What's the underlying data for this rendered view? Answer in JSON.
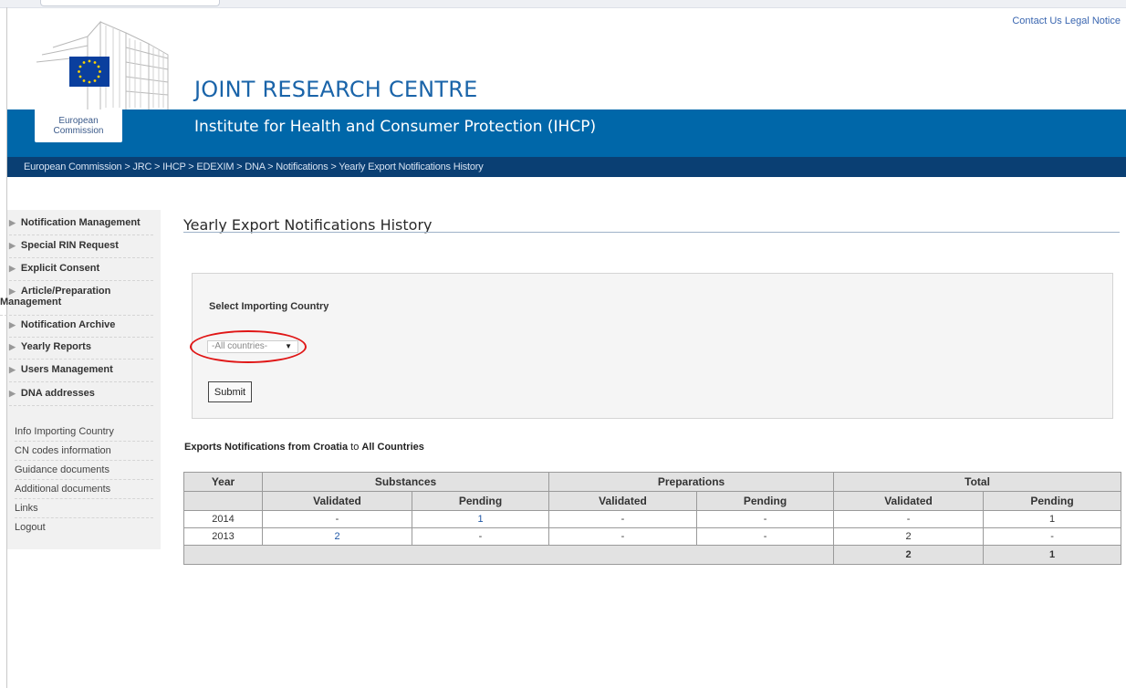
{
  "header": {
    "contact_us": "Contact Us",
    "legal_notice": "Legal Notice",
    "org_title": "JOINT RESEARCH CENTRE",
    "institute": "Institute for Health and Consumer Protection (IHCP)",
    "ec_label_line1": "European",
    "ec_label_line2": "Commission"
  },
  "breadcrumb": "European Commission > JRC > IHCP > EDEXIM > DNA > Notifications > Yearly Export Notifications History",
  "sidebar": {
    "nav": [
      {
        "label": "Notification Management"
      },
      {
        "label": "Special RIN Request"
      },
      {
        "label": "Explicit Consent"
      },
      {
        "label": "Article/Preparation Management"
      },
      {
        "label": "Notification Archive"
      },
      {
        "label": "Yearly Reports"
      },
      {
        "label": "Users Management"
      },
      {
        "label": "DNA addresses"
      }
    ],
    "links": [
      {
        "label": "Info Importing Country"
      },
      {
        "label": "CN codes information"
      },
      {
        "label": "Guidance documents"
      },
      {
        "label": "Additional documents"
      },
      {
        "label": "Links"
      },
      {
        "label": "Logout"
      }
    ]
  },
  "main": {
    "page_title": "Yearly Export Notifications History",
    "select_label": "Select Importing Country",
    "select_value": "-All countries-",
    "submit_label": "Submit",
    "exports_heading": {
      "prefix": "Exports Notifications from",
      "from_country": "Croatia",
      "mid": "to",
      "to_country": "All Countries"
    }
  },
  "table": {
    "headers": {
      "year": "Year",
      "substances": "Substances",
      "preparations": "Preparations",
      "total": "Total",
      "validated": "Validated",
      "pending": "Pending"
    },
    "rows": [
      {
        "year": "2014",
        "sub_validated": "-",
        "sub_pending": "1",
        "prep_validated": "-",
        "prep_pending": "-",
        "total_validated": "-",
        "total_pending": "1"
      },
      {
        "year": "2013",
        "sub_validated": "2",
        "sub_pending": "-",
        "prep_validated": "-",
        "prep_pending": "-",
        "total_validated": "2",
        "total_pending": "-"
      }
    ],
    "totals": {
      "validated": "2",
      "pending": "1"
    }
  },
  "colors": {
    "band_blue": "#0067a9",
    "breadcrumb_navy": "#0a3f73",
    "title_blue": "#1a64a9",
    "highlight_red": "#e01616",
    "link_blue": "#1f57a6"
  }
}
